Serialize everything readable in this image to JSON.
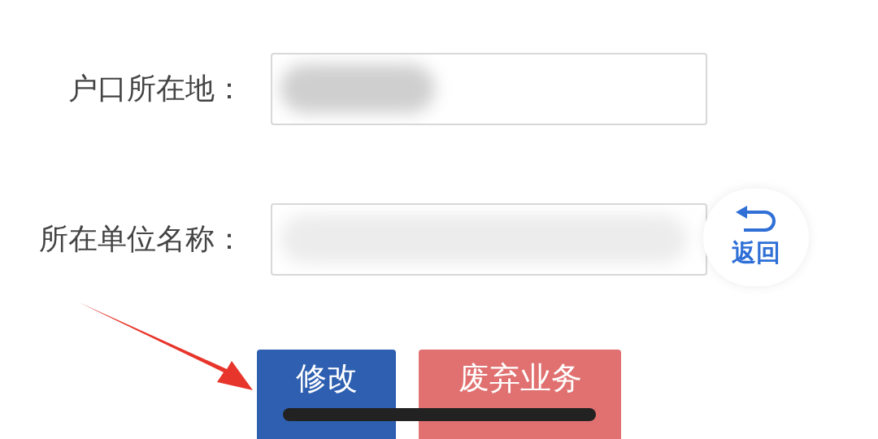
{
  "fields": [
    {
      "label": "户口所在地：",
      "redacted": true
    },
    {
      "label": "所在单位名称：",
      "redacted": true
    }
  ],
  "back_button": {
    "label": "返回"
  },
  "buttons": [
    {
      "label": "修改",
      "kind": "primary"
    },
    {
      "label": "废弃业务",
      "kind": "danger"
    }
  ]
}
